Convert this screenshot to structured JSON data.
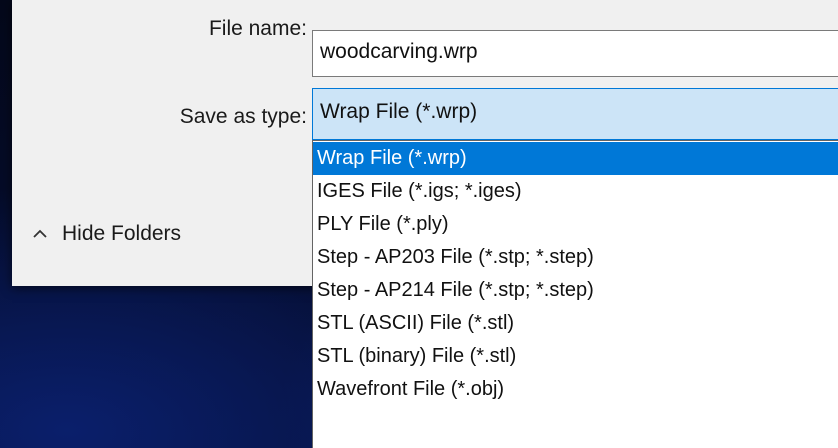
{
  "dialog": {
    "file_name_label": "File name:",
    "file_name_value": "woodcarving.wrp",
    "save_as_type_label": "Save as type:",
    "save_as_type_value": "Wrap File (*.wrp)",
    "hide_folders_label": "Hide Folders",
    "hide_folders_icon": "chevron-up-icon"
  },
  "type_options": [
    "Wrap File (*.wrp)",
    "IGES File (*.igs; *.iges)",
    "PLY File (*.ply)",
    "Step - AP203 File (*.stp; *.step)",
    "Step - AP214 File (*.stp; *.step)",
    "STL (ASCII) File (*.stl)",
    "STL (binary) File (*.stl)",
    "Wavefront File (*.obj)"
  ],
  "selected_option": "Wrap File (*.wrp)",
  "colors": {
    "selection": "#0078d7",
    "select_highlight": "#cce4f7",
    "dialog_bg": "#f0f0f0",
    "desktop_bg": "#06103a"
  }
}
